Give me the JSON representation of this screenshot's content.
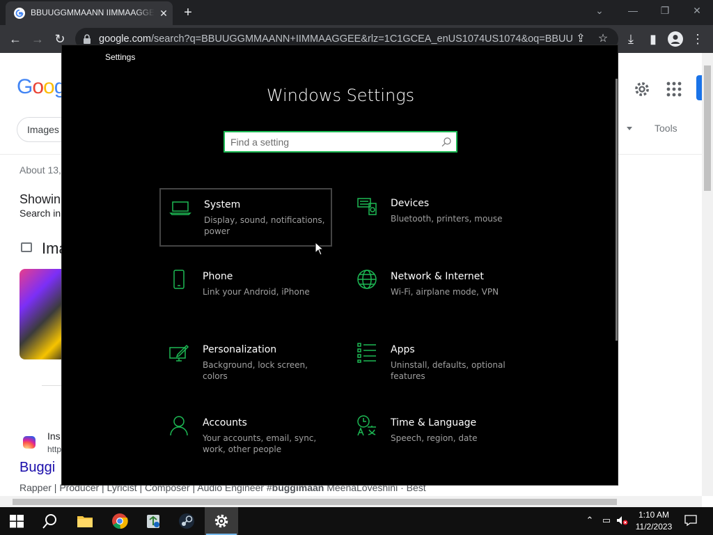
{
  "browser": {
    "tab_title": "BBUUGGMMAANN IIMMAAGGEE",
    "tab_close": "✕",
    "new_tab": "+",
    "url_host": "google.com",
    "url_path": "/search?q=BBUUGGMMAANN+IIMMAAGGEE&rlz=1C1GCEA_enUS1074US1074&oq=BBUUGG..."
  },
  "google": {
    "logo": "Goog",
    "chip_images": "Images",
    "tools": "Tools",
    "about": "About 13,",
    "showing": "Showin",
    "search_in": "Search in",
    "images_heading": "Ima",
    "result_site": "Ins",
    "result_url": "http",
    "result_title": "Buggi",
    "result_snippet_pre": "Rapper | Producer | Lyricist | Composer | Audio Engineer #",
    "result_snippet_bold": "buggimaan",
    "result_snippet_post": " MeenaLoveshini · Best"
  },
  "settings": {
    "window_title": "Settings",
    "heading": "Windows Settings",
    "search_placeholder": "Find a setting",
    "accent_color": "#1db954",
    "tiles": [
      {
        "name": "System",
        "desc": "Display, sound, notifications, power",
        "icon": "laptop-icon"
      },
      {
        "name": "Devices",
        "desc": "Bluetooth, printers, mouse",
        "icon": "devices-icon"
      },
      {
        "name": "Phone",
        "desc": "Link your Android, iPhone",
        "icon": "phone-icon"
      },
      {
        "name": "Network & Internet",
        "desc": "Wi-Fi, airplane mode, VPN",
        "icon": "globe-icon"
      },
      {
        "name": "Personalization",
        "desc": "Background, lock screen, colors",
        "icon": "paint-icon"
      },
      {
        "name": "Apps",
        "desc": "Uninstall, defaults, optional features",
        "icon": "apps-list-icon"
      },
      {
        "name": "Accounts",
        "desc": "Your accounts, email, sync, work, other people",
        "icon": "person-icon"
      },
      {
        "name": "Time & Language",
        "desc": "Speech, region, date",
        "icon": "time-language-icon"
      }
    ]
  },
  "taskbar": {
    "time": "1:10 AM",
    "date": "11/2/2023",
    "apps": [
      "start-icon",
      "search-icon",
      "file-explorer-icon",
      "chrome-icon",
      "recycle-icon",
      "steam-icon",
      "settings-gear-icon"
    ]
  }
}
